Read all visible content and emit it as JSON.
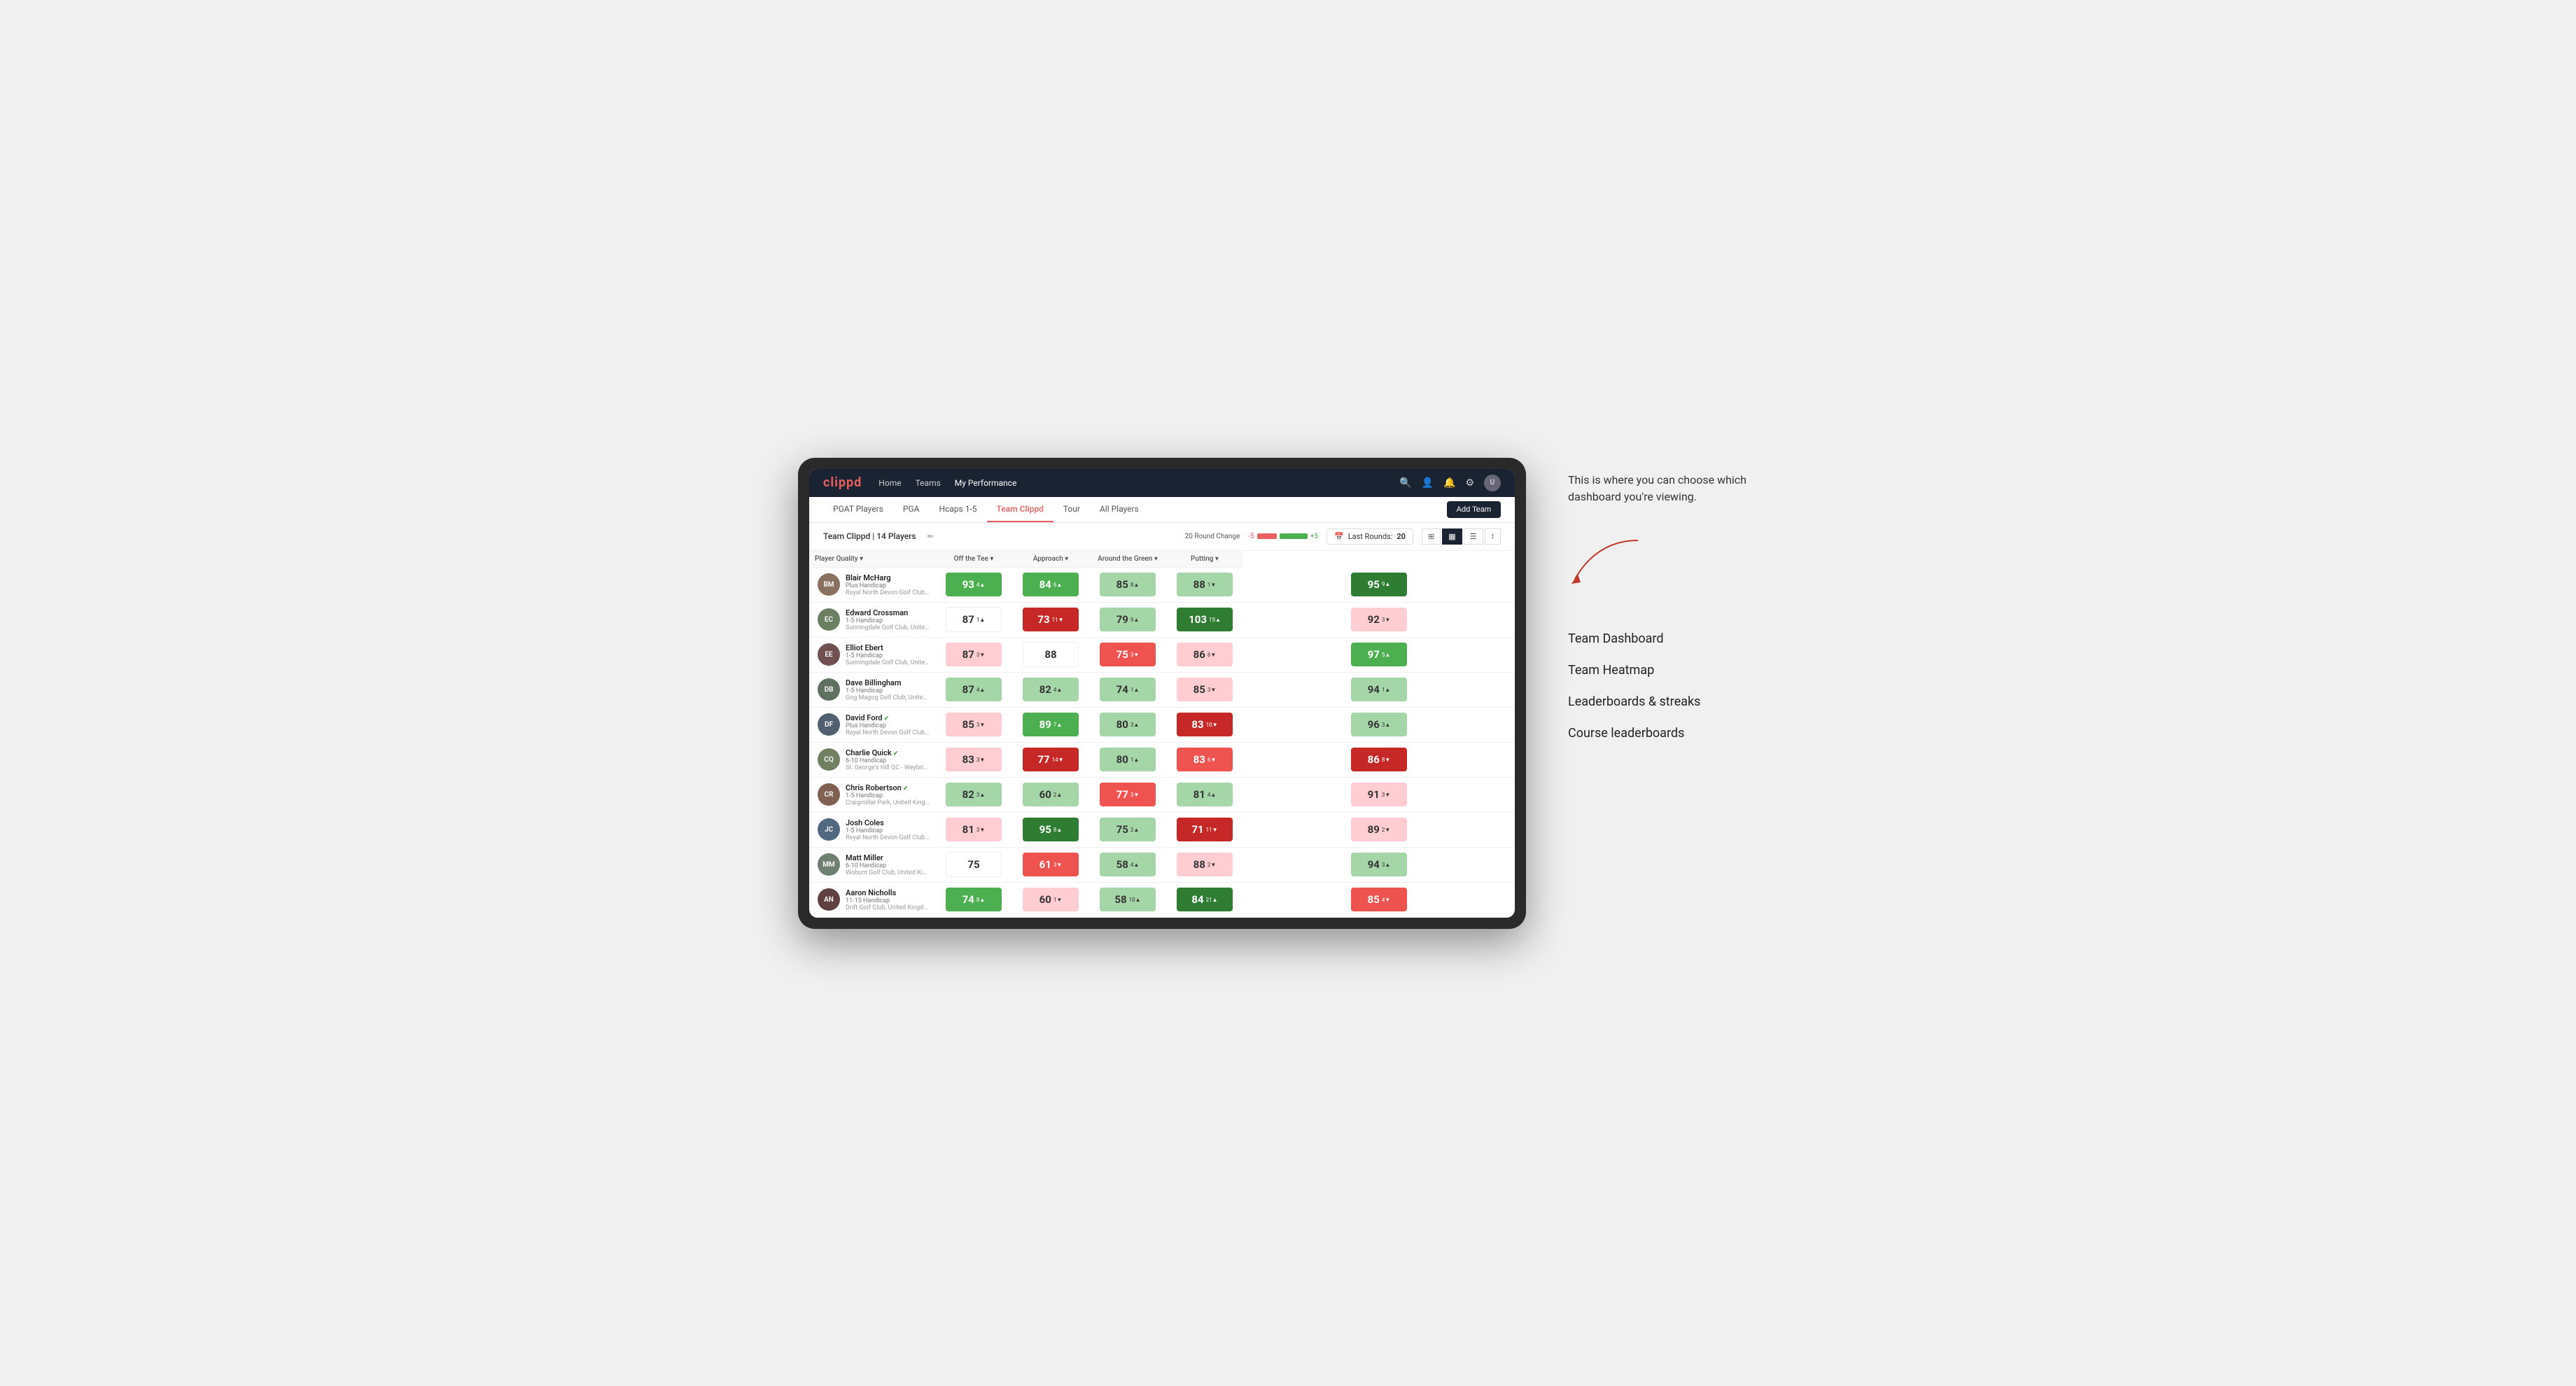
{
  "nav": {
    "logo": "clippd",
    "items": [
      {
        "label": "Home",
        "active": false
      },
      {
        "label": "Teams",
        "active": false
      },
      {
        "label": "My Performance",
        "active": true
      }
    ],
    "icons": [
      "search",
      "user",
      "bell",
      "settings",
      "avatar"
    ]
  },
  "subNav": {
    "tabs": [
      {
        "label": "PGAT Players",
        "active": false
      },
      {
        "label": "PGA",
        "active": false
      },
      {
        "label": "Hcaps 1-5",
        "active": false
      },
      {
        "label": "Team Clippd",
        "active": true
      },
      {
        "label": "Tour",
        "active": false
      },
      {
        "label": "All Players",
        "active": false
      }
    ],
    "addTeamLabel": "Add Team"
  },
  "teamHeader": {
    "title": "Team Clippd | 14 Players",
    "roundChangeLabel": "20 Round Change",
    "negLabel": "-5",
    "posLabel": "+5",
    "lastRoundsLabel": "Last Rounds:",
    "lastRoundsValue": "20",
    "viewOptions": [
      "grid",
      "heatmap",
      "list",
      "settings"
    ]
  },
  "tableHeaders": {
    "playerQuality": "Player Quality ▾",
    "offTee": "Off the Tee ▾",
    "approach": "Approach ▾",
    "aroundGreen": "Around the Green ▾",
    "putting": "Putting ▾"
  },
  "players": [
    {
      "name": "Blair McHarg",
      "handicap": "Plus Handicap",
      "club": "Royal North Devon Golf Club, United Kingdom",
      "avatarInitials": "BM",
      "avatarColor": "#8a7060",
      "verified": false,
      "playerQuality": {
        "value": 93,
        "change": "4",
        "dir": "up",
        "color": "green-mid"
      },
      "offTee": {
        "value": 84,
        "change": "6",
        "dir": "up",
        "color": "green-mid"
      },
      "approach": {
        "value": 85,
        "change": "8",
        "dir": "up",
        "color": "green-light"
      },
      "aroundGreen": {
        "value": 88,
        "change": "1",
        "dir": "down",
        "color": "green-light"
      },
      "putting": {
        "value": 95,
        "change": "9",
        "dir": "up",
        "color": "green-dark"
      }
    },
    {
      "name": "Edward Crossman",
      "handicap": "1-5 Handicap",
      "club": "Sunningdale Golf Club, United Kingdom",
      "avatarInitials": "EC",
      "avatarColor": "#6a8060",
      "verified": false,
      "playerQuality": {
        "value": 87,
        "change": "1",
        "dir": "up",
        "color": "neutral"
      },
      "offTee": {
        "value": 73,
        "change": "11",
        "dir": "down",
        "color": "red-dark"
      },
      "approach": {
        "value": 79,
        "change": "9",
        "dir": "up",
        "color": "green-light"
      },
      "aroundGreen": {
        "value": 103,
        "change": "15",
        "dir": "up",
        "color": "green-dark"
      },
      "putting": {
        "value": 92,
        "change": "3",
        "dir": "down",
        "color": "red-light"
      }
    },
    {
      "name": "Elliot Ebert",
      "handicap": "1-5 Handicap",
      "club": "Sunningdale Golf Club, United Kingdom",
      "avatarInitials": "EE",
      "avatarColor": "#705050",
      "verified": false,
      "playerQuality": {
        "value": 87,
        "change": "3",
        "dir": "down",
        "color": "red-light"
      },
      "offTee": {
        "value": 88,
        "change": "",
        "dir": "none",
        "color": "neutral"
      },
      "approach": {
        "value": 75,
        "change": "3",
        "dir": "down",
        "color": "red-mid"
      },
      "aroundGreen": {
        "value": 86,
        "change": "6",
        "dir": "down",
        "color": "red-light"
      },
      "putting": {
        "value": 97,
        "change": "5",
        "dir": "up",
        "color": "green-mid"
      }
    },
    {
      "name": "Dave Billingham",
      "handicap": "1-5 Handicap",
      "club": "Gog Magog Golf Club, United Kingdom",
      "avatarInitials": "DB",
      "avatarColor": "#607060",
      "verified": false,
      "playerQuality": {
        "value": 87,
        "change": "4",
        "dir": "up",
        "color": "green-light"
      },
      "offTee": {
        "value": 82,
        "change": "4",
        "dir": "up",
        "color": "green-light"
      },
      "approach": {
        "value": 74,
        "change": "1",
        "dir": "up",
        "color": "green-light"
      },
      "aroundGreen": {
        "value": 85,
        "change": "3",
        "dir": "down",
        "color": "red-light"
      },
      "putting": {
        "value": 94,
        "change": "1",
        "dir": "up",
        "color": "green-light"
      }
    },
    {
      "name": "David Ford",
      "handicap": "Plus Handicap",
      "club": "Royal North Devon Golf Club, United Kingdom",
      "avatarInitials": "DF",
      "avatarColor": "#506070",
      "verified": true,
      "playerQuality": {
        "value": 85,
        "change": "3",
        "dir": "down",
        "color": "red-light"
      },
      "offTee": {
        "value": 89,
        "change": "7",
        "dir": "up",
        "color": "green-mid"
      },
      "approach": {
        "value": 80,
        "change": "3",
        "dir": "up",
        "color": "green-light"
      },
      "aroundGreen": {
        "value": 83,
        "change": "10",
        "dir": "down",
        "color": "red-dark"
      },
      "putting": {
        "value": 96,
        "change": "3",
        "dir": "up",
        "color": "green-light"
      }
    },
    {
      "name": "Charlie Quick",
      "handicap": "6-10 Handicap",
      "club": "St. George's Hill GC - Weybridge, Surrey, Uni...",
      "avatarInitials": "CQ",
      "avatarColor": "#708060",
      "verified": true,
      "playerQuality": {
        "value": 83,
        "change": "3",
        "dir": "down",
        "color": "red-light"
      },
      "offTee": {
        "value": 77,
        "change": "14",
        "dir": "down",
        "color": "red-dark"
      },
      "approach": {
        "value": 80,
        "change": "1",
        "dir": "up",
        "color": "green-light"
      },
      "aroundGreen": {
        "value": 83,
        "change": "6",
        "dir": "down",
        "color": "red-mid"
      },
      "putting": {
        "value": 86,
        "change": "8",
        "dir": "down",
        "color": "red-dark"
      }
    },
    {
      "name": "Chris Robertson",
      "handicap": "1-5 Handicap",
      "club": "Craigmillar Park, United Kingdom",
      "avatarInitials": "CR",
      "avatarColor": "#806050",
      "verified": true,
      "playerQuality": {
        "value": 82,
        "change": "3",
        "dir": "up",
        "color": "green-light"
      },
      "offTee": {
        "value": 60,
        "change": "2",
        "dir": "up",
        "color": "green-light"
      },
      "approach": {
        "value": 77,
        "change": "3",
        "dir": "down",
        "color": "red-mid"
      },
      "aroundGreen": {
        "value": 81,
        "change": "4",
        "dir": "up",
        "color": "green-light"
      },
      "putting": {
        "value": 91,
        "change": "3",
        "dir": "down",
        "color": "red-light"
      }
    },
    {
      "name": "Josh Coles",
      "handicap": "1-5 Handicap",
      "club": "Royal North Devon Golf Club, United Kingdom",
      "avatarInitials": "JC",
      "avatarColor": "#506880",
      "verified": false,
      "playerQuality": {
        "value": 81,
        "change": "3",
        "dir": "down",
        "color": "red-light"
      },
      "offTee": {
        "value": 95,
        "change": "8",
        "dir": "up",
        "color": "green-dark"
      },
      "approach": {
        "value": 75,
        "change": "2",
        "dir": "up",
        "color": "green-light"
      },
      "aroundGreen": {
        "value": 71,
        "change": "11",
        "dir": "down",
        "color": "red-dark"
      },
      "putting": {
        "value": 89,
        "change": "2",
        "dir": "down",
        "color": "red-light"
      }
    },
    {
      "name": "Matt Miller",
      "handicap": "6-10 Handicap",
      "club": "Woburn Golf Club, United Kingdom",
      "avatarInitials": "MM",
      "avatarColor": "#708070",
      "verified": false,
      "playerQuality": {
        "value": 75,
        "change": "",
        "dir": "none",
        "color": "neutral"
      },
      "offTee": {
        "value": 61,
        "change": "3",
        "dir": "down",
        "color": "red-mid"
      },
      "approach": {
        "value": 58,
        "change": "4",
        "dir": "up",
        "color": "green-light"
      },
      "aroundGreen": {
        "value": 88,
        "change": "2",
        "dir": "down",
        "color": "red-light"
      },
      "putting": {
        "value": 94,
        "change": "3",
        "dir": "up",
        "color": "green-light"
      }
    },
    {
      "name": "Aaron Nicholls",
      "handicap": "11-15 Handicap",
      "club": "Drift Golf Club, United Kingdom",
      "avatarInitials": "AN",
      "avatarColor": "#604040",
      "verified": false,
      "playerQuality": {
        "value": 74,
        "change": "8",
        "dir": "up",
        "color": "green-mid"
      },
      "offTee": {
        "value": 60,
        "change": "1",
        "dir": "down",
        "color": "red-light"
      },
      "approach": {
        "value": 58,
        "change": "10",
        "dir": "up",
        "color": "green-light"
      },
      "aroundGreen": {
        "value": 84,
        "change": "21",
        "dir": "up",
        "color": "green-dark"
      },
      "putting": {
        "value": 85,
        "change": "4",
        "dir": "down",
        "color": "red-mid"
      }
    }
  ],
  "annotation": {
    "introText": "This is where you can choose which dashboard you're viewing.",
    "options": [
      "Team Dashboard",
      "Team Heatmap",
      "Leaderboards & streaks",
      "Course leaderboards"
    ]
  }
}
